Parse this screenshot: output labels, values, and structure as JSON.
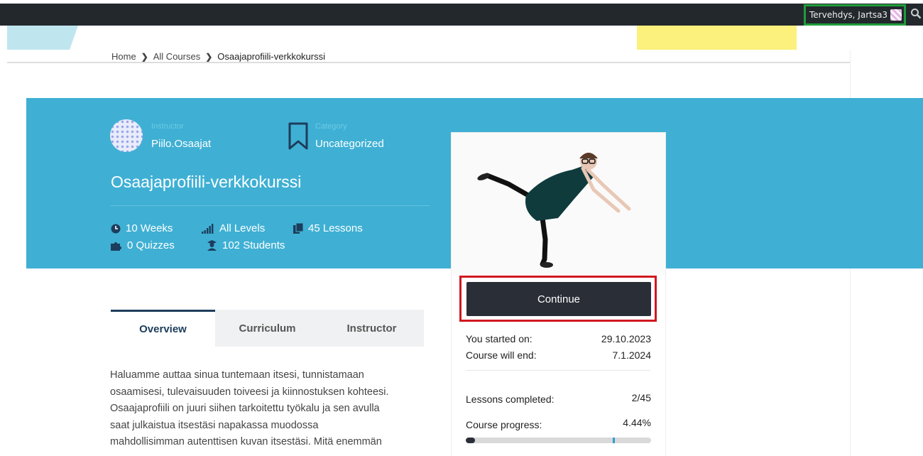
{
  "topbar": {
    "greeting": "Tervehdys, Jartsa3"
  },
  "breadcrumb": {
    "items": [
      "Home",
      "All Courses"
    ],
    "current": "Osaajaprofiili-verkkokurssi"
  },
  "course": {
    "instructor_label": "Instructor",
    "instructor_name": "Piilo.Osaajat",
    "category_label": "Category",
    "category_name": "Uncategorized",
    "title": "Osaajaprofiili-verkkokurssi",
    "stats": {
      "duration": "10 Weeks",
      "level": "All Levels",
      "lessons": "45 Lessons",
      "quizzes": "0 Quizzes",
      "students": "102 Students"
    }
  },
  "card": {
    "continue_label": "Continue",
    "started_label": "You started on:",
    "started_value": "29.10.2023",
    "end_label": "Course will end:",
    "end_value": "7.1.2024",
    "lessons_label": "Lessons completed:",
    "lessons_value": "2/45",
    "progress_label": "Course progress:",
    "progress_value": "4.44%",
    "progress_fraction": 0.0444
  },
  "tabs": [
    "Overview",
    "Curriculum",
    "Instructor"
  ],
  "overview_lines": [
    "Haluamme auttaa sinua tuntemaan itsesi, tunnistamaan",
    "osaamisesi, tulevaisuuden toiveesi ja kiinnostuksen kohteesi.",
    "Osaajaprofiili on juuri siihen tarkoitettu työkalu ja sen avulla",
    "saat julkaistua itsestäsi napakassa muodossa",
    "mahdollisimman autenttisen kuvan itsestäsi. Mitä enemmän"
  ],
  "colors": {
    "hero": "#3fb0d4",
    "button": "#2a2f37",
    "highlight_red": "#d0181f",
    "highlight_green": "#1f9d3a"
  }
}
